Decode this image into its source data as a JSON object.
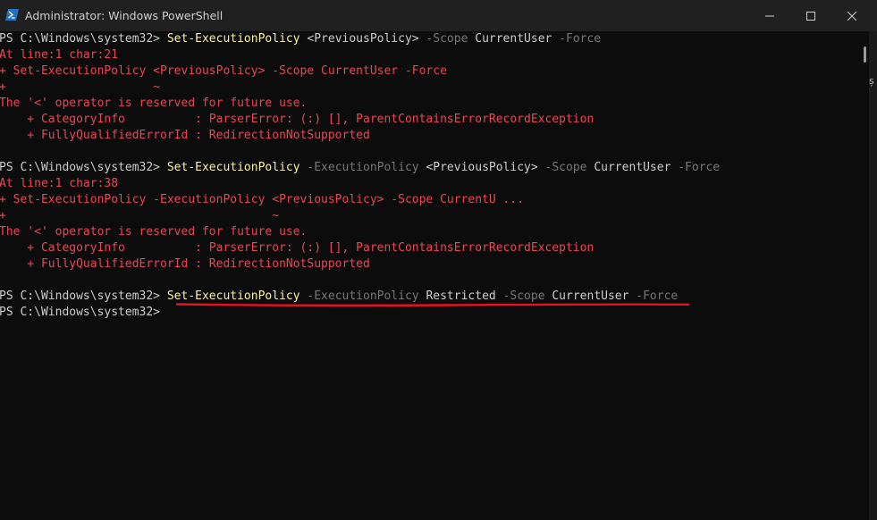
{
  "window": {
    "title": "Administrator: Windows PowerShell",
    "icon": "powershell-icon",
    "controls": [
      "minimize-icon",
      "maximize-icon",
      "close-icon"
    ]
  },
  "colors": {
    "background": "#0c0c0c",
    "titlebar": "#202020",
    "cmdlet": "#f9f1a5",
    "parameter": "#767676",
    "error": "#e74856",
    "highlight_underline": "#e81123"
  },
  "terminal": {
    "lines": [
      {
        "prompt": "PS C:\\Windows\\system32> ",
        "cmdlet": "Set-ExecutionPolicy",
        "sp1": " ",
        "arg1": "<PreviousPolicy>",
        "sp2": " ",
        "p1": "-Scope",
        "sp3": " ",
        "arg2": "CurrentUser",
        "sp4": " ",
        "p2": "-Force"
      },
      {
        "text": "At line:1 char:21"
      },
      {
        "text": "+ Set-ExecutionPolicy <PreviousPolicy> -Scope CurrentUser -Force"
      },
      {
        "text": "+                     ~"
      },
      {
        "text": "The '<' operator is reserved for future use."
      },
      {
        "text": "    + CategoryInfo          : ParserError: (:) [], ParentContainsErrorRecordException"
      },
      {
        "text": "    + FullyQualifiedErrorId : RedirectionNotSupported"
      },
      {
        "prompt": "PS C:\\Windows\\system32> ",
        "cmdlet": "Set-ExecutionPolicy",
        "sp1": " ",
        "p1": "-ExecutionPolicy",
        "sp2": " ",
        "arg1": "<PreviousPolicy>",
        "sp3": " ",
        "p2": "-Scope",
        "sp4": " ",
        "arg2": "CurrentUser",
        "sp5": " ",
        "p3": "-Force"
      },
      {
        "text": "At line:1 char:38"
      },
      {
        "text": "+ Set-ExecutionPolicy -ExecutionPolicy <PreviousPolicy> -Scope CurrentU ..."
      },
      {
        "text": "+                                      ~"
      },
      {
        "text": "The '<' operator is reserved for future use."
      },
      {
        "text": "    + CategoryInfo          : ParserError: (:) [], ParentContainsErrorRecordException"
      },
      {
        "text": "    + FullyQualifiedErrorId : RedirectionNotSupported"
      },
      {
        "prompt": "PS C:\\Windows\\system32> ",
        "cmdlet": "Set-ExecutionPolicy",
        "sp1": " ",
        "p1": "-ExecutionPolicy",
        "sp2": " ",
        "arg1": "Restricted",
        "sp3": " ",
        "p2": "-Scope",
        "sp4": " ",
        "arg2": "CurrentUser",
        "sp5": " ",
        "p3": "-Force"
      },
      {
        "prompt": "PS C:\\Windows\\system32> "
      }
    ]
  },
  "right_edge_mark": "ș"
}
